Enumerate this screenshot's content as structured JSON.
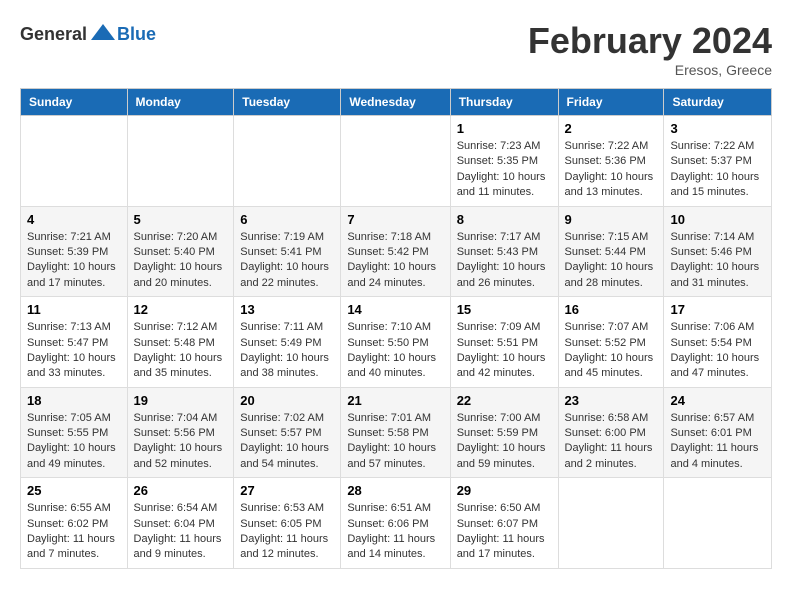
{
  "header": {
    "logo_general": "General",
    "logo_blue": "Blue",
    "month_title": "February 2024",
    "location": "Eresos, Greece"
  },
  "columns": [
    "Sunday",
    "Monday",
    "Tuesday",
    "Wednesday",
    "Thursday",
    "Friday",
    "Saturday"
  ],
  "weeks": [
    {
      "days": [
        {
          "num": "",
          "detail": "",
          "empty": true
        },
        {
          "num": "",
          "detail": "",
          "empty": true
        },
        {
          "num": "",
          "detail": "",
          "empty": true
        },
        {
          "num": "",
          "detail": "",
          "empty": true
        },
        {
          "num": "1",
          "detail": "Sunrise: 7:23 AM\nSunset: 5:35 PM\nDaylight: 10 hours and 11 minutes."
        },
        {
          "num": "2",
          "detail": "Sunrise: 7:22 AM\nSunset: 5:36 PM\nDaylight: 10 hours and 13 minutes."
        },
        {
          "num": "3",
          "detail": "Sunrise: 7:22 AM\nSunset: 5:37 PM\nDaylight: 10 hours and 15 minutes."
        }
      ]
    },
    {
      "days": [
        {
          "num": "4",
          "detail": "Sunrise: 7:21 AM\nSunset: 5:39 PM\nDaylight: 10 hours and 17 minutes."
        },
        {
          "num": "5",
          "detail": "Sunrise: 7:20 AM\nSunset: 5:40 PM\nDaylight: 10 hours and 20 minutes."
        },
        {
          "num": "6",
          "detail": "Sunrise: 7:19 AM\nSunset: 5:41 PM\nDaylight: 10 hours and 22 minutes."
        },
        {
          "num": "7",
          "detail": "Sunrise: 7:18 AM\nSunset: 5:42 PM\nDaylight: 10 hours and 24 minutes."
        },
        {
          "num": "8",
          "detail": "Sunrise: 7:17 AM\nSunset: 5:43 PM\nDaylight: 10 hours and 26 minutes."
        },
        {
          "num": "9",
          "detail": "Sunrise: 7:15 AM\nSunset: 5:44 PM\nDaylight: 10 hours and 28 minutes."
        },
        {
          "num": "10",
          "detail": "Sunrise: 7:14 AM\nSunset: 5:46 PM\nDaylight: 10 hours and 31 minutes."
        }
      ]
    },
    {
      "days": [
        {
          "num": "11",
          "detail": "Sunrise: 7:13 AM\nSunset: 5:47 PM\nDaylight: 10 hours and 33 minutes."
        },
        {
          "num": "12",
          "detail": "Sunrise: 7:12 AM\nSunset: 5:48 PM\nDaylight: 10 hours and 35 minutes."
        },
        {
          "num": "13",
          "detail": "Sunrise: 7:11 AM\nSunset: 5:49 PM\nDaylight: 10 hours and 38 minutes."
        },
        {
          "num": "14",
          "detail": "Sunrise: 7:10 AM\nSunset: 5:50 PM\nDaylight: 10 hours and 40 minutes."
        },
        {
          "num": "15",
          "detail": "Sunrise: 7:09 AM\nSunset: 5:51 PM\nDaylight: 10 hours and 42 minutes."
        },
        {
          "num": "16",
          "detail": "Sunrise: 7:07 AM\nSunset: 5:52 PM\nDaylight: 10 hours and 45 minutes."
        },
        {
          "num": "17",
          "detail": "Sunrise: 7:06 AM\nSunset: 5:54 PM\nDaylight: 10 hours and 47 minutes."
        }
      ]
    },
    {
      "days": [
        {
          "num": "18",
          "detail": "Sunrise: 7:05 AM\nSunset: 5:55 PM\nDaylight: 10 hours and 49 minutes."
        },
        {
          "num": "19",
          "detail": "Sunrise: 7:04 AM\nSunset: 5:56 PM\nDaylight: 10 hours and 52 minutes."
        },
        {
          "num": "20",
          "detail": "Sunrise: 7:02 AM\nSunset: 5:57 PM\nDaylight: 10 hours and 54 minutes."
        },
        {
          "num": "21",
          "detail": "Sunrise: 7:01 AM\nSunset: 5:58 PM\nDaylight: 10 hours and 57 minutes."
        },
        {
          "num": "22",
          "detail": "Sunrise: 7:00 AM\nSunset: 5:59 PM\nDaylight: 10 hours and 59 minutes."
        },
        {
          "num": "23",
          "detail": "Sunrise: 6:58 AM\nSunset: 6:00 PM\nDaylight: 11 hours and 2 minutes."
        },
        {
          "num": "24",
          "detail": "Sunrise: 6:57 AM\nSunset: 6:01 PM\nDaylight: 11 hours and 4 minutes."
        }
      ]
    },
    {
      "days": [
        {
          "num": "25",
          "detail": "Sunrise: 6:55 AM\nSunset: 6:02 PM\nDaylight: 11 hours and 7 minutes."
        },
        {
          "num": "26",
          "detail": "Sunrise: 6:54 AM\nSunset: 6:04 PM\nDaylight: 11 hours and 9 minutes."
        },
        {
          "num": "27",
          "detail": "Sunrise: 6:53 AM\nSunset: 6:05 PM\nDaylight: 11 hours and 12 minutes."
        },
        {
          "num": "28",
          "detail": "Sunrise: 6:51 AM\nSunset: 6:06 PM\nDaylight: 11 hours and 14 minutes."
        },
        {
          "num": "29",
          "detail": "Sunrise: 6:50 AM\nSunset: 6:07 PM\nDaylight: 11 hours and 17 minutes."
        },
        {
          "num": "",
          "detail": "",
          "empty": true
        },
        {
          "num": "",
          "detail": "",
          "empty": true
        }
      ]
    }
  ]
}
